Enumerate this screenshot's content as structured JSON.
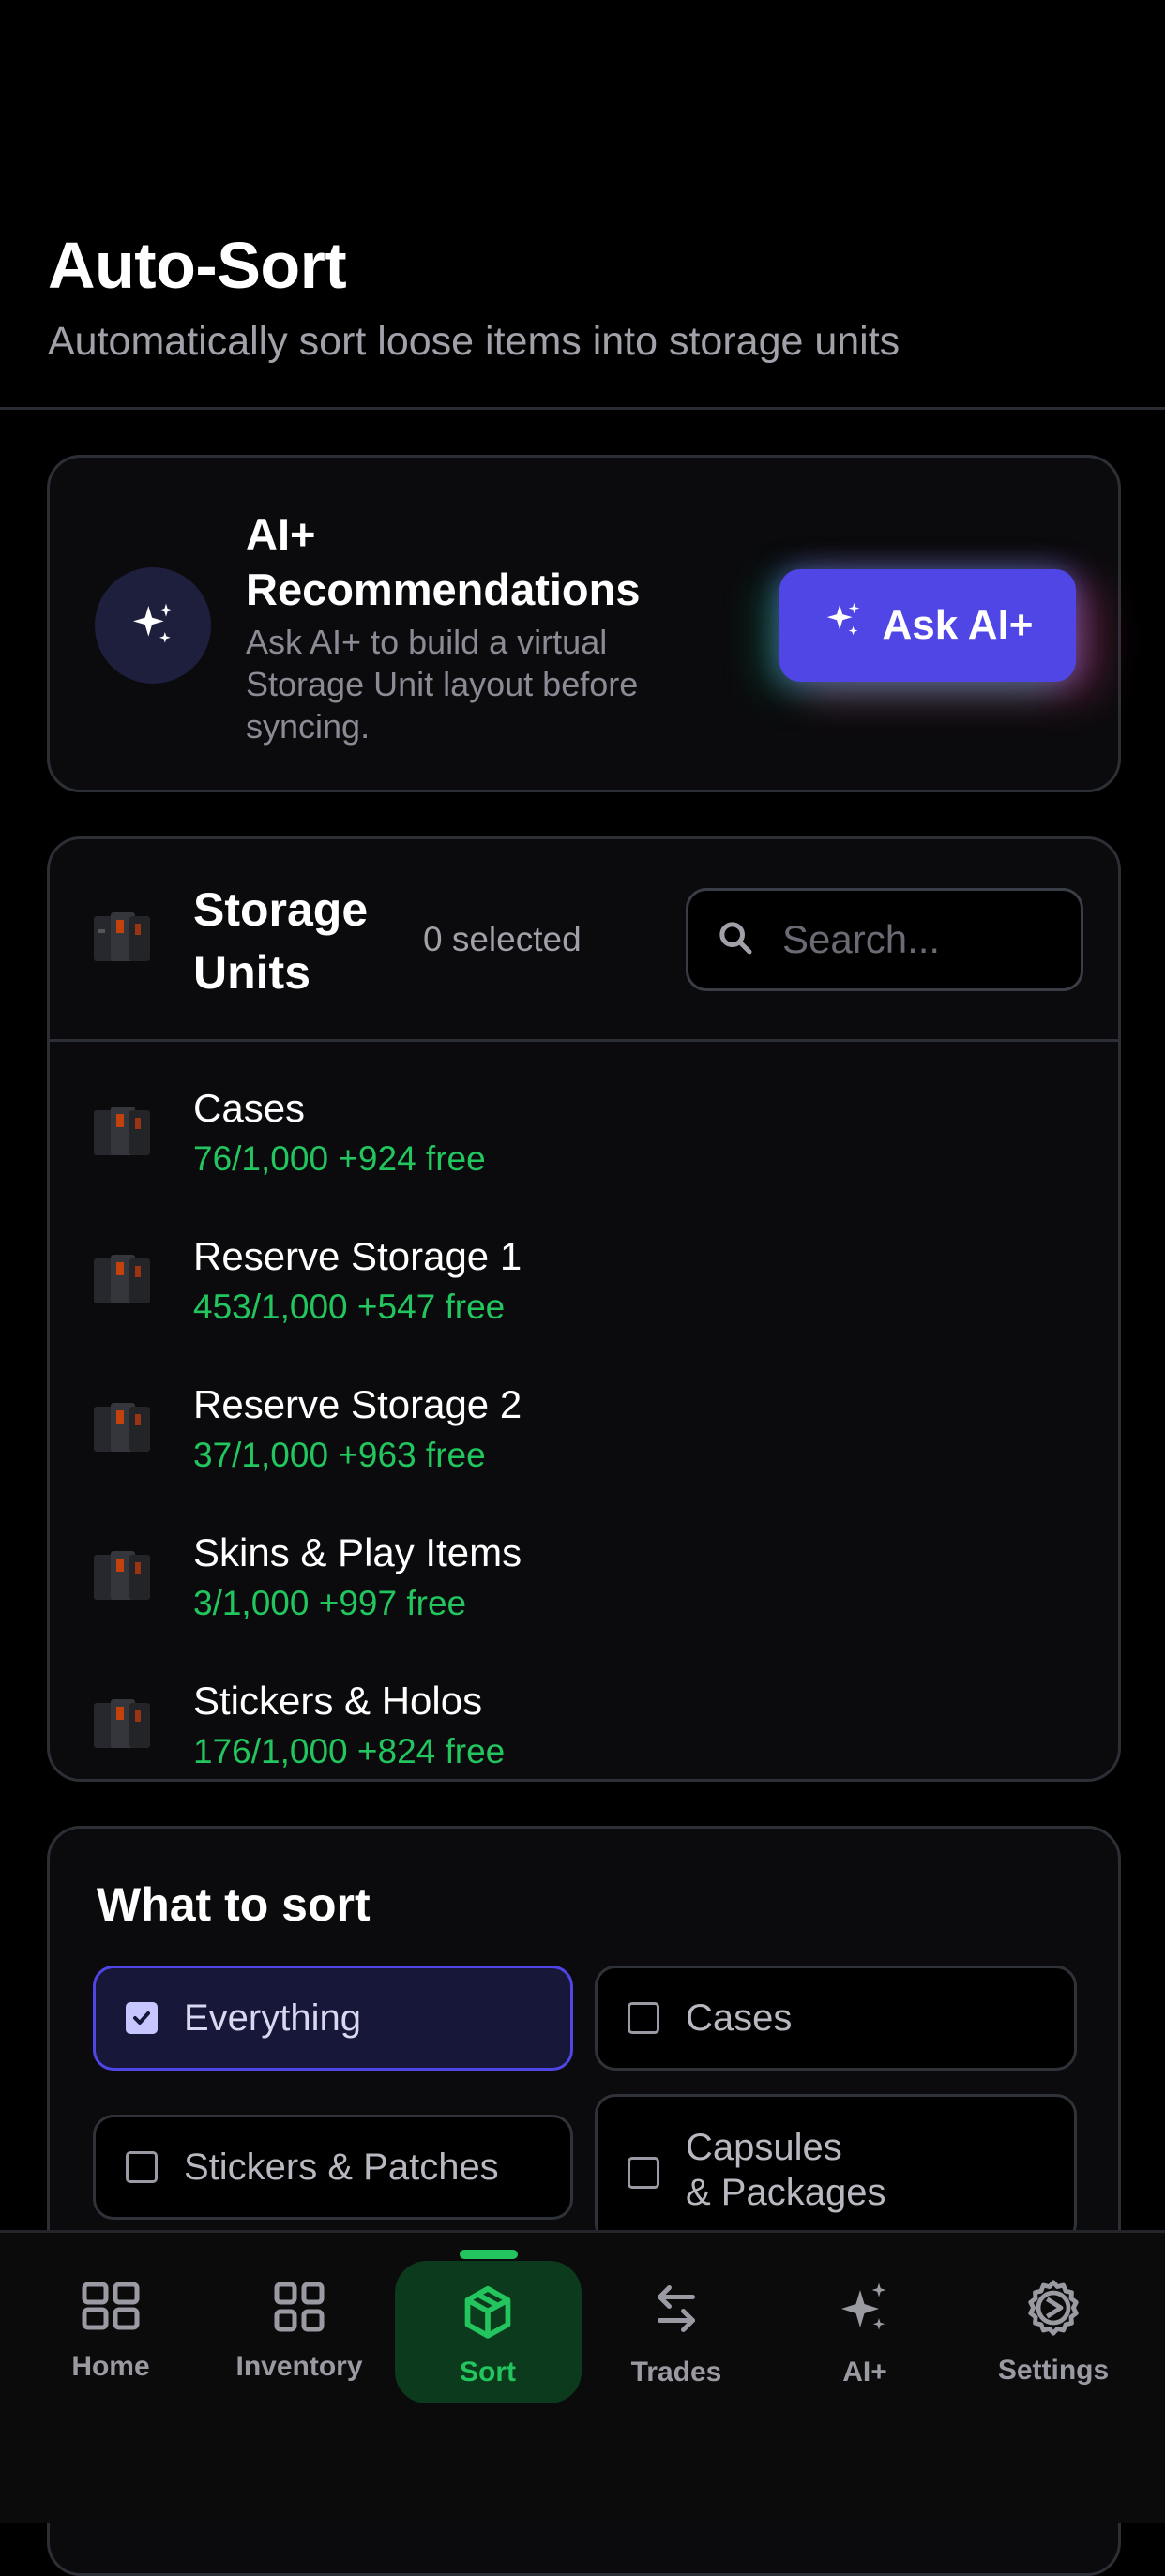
{
  "header": {
    "title": "Auto-Sort",
    "subtitle": "Automatically sort loose items into storage units"
  },
  "ai_card": {
    "title": "AI+ Recommendations",
    "description": "Ask AI+ to build a virtual Storage Unit layout before syncing.",
    "button_label": "Ask AI+",
    "icon": "sparkles-icon"
  },
  "storage_units": {
    "title": "Storage Units",
    "selected_label": "0 selected",
    "search_placeholder": "Search...",
    "items": [
      {
        "name": "Cases",
        "capacity": "76/1,000 +924 free"
      },
      {
        "name": "Reserve Storage 1",
        "capacity": "453/1,000 +547 free"
      },
      {
        "name": "Reserve Storage 2",
        "capacity": "37/1,000 +963 free"
      },
      {
        "name": "Skins & Play Items",
        "capacity": "3/1,000 +997 free"
      },
      {
        "name": "Stickers & Holos",
        "capacity": "176/1,000 +824 free"
      }
    ]
  },
  "what_to_sort": {
    "title": "What to sort",
    "options": [
      {
        "label": "Everything",
        "checked": true
      },
      {
        "label": "Cases",
        "checked": false
      },
      {
        "label": "Stickers & Patches",
        "checked": false
      },
      {
        "label_line1": "Capsules",
        "label_line2": "& Packages",
        "checked": false
      }
    ]
  },
  "nav": {
    "items": [
      {
        "label": "Home",
        "icon": "grid-icon"
      },
      {
        "label": "Inventory",
        "icon": "grid-icon"
      },
      {
        "label": "Sort",
        "icon": "cube-icon",
        "active": true
      },
      {
        "label": "Trades",
        "icon": "arrows-exchange-icon"
      },
      {
        "label": "AI+",
        "icon": "sparkles-icon"
      },
      {
        "label": "Settings",
        "icon": "gear-icon"
      }
    ]
  },
  "colors": {
    "accent": "#4f46e5",
    "positive": "#22c55e",
    "background": "#000000",
    "card": "#0b0b0d"
  }
}
